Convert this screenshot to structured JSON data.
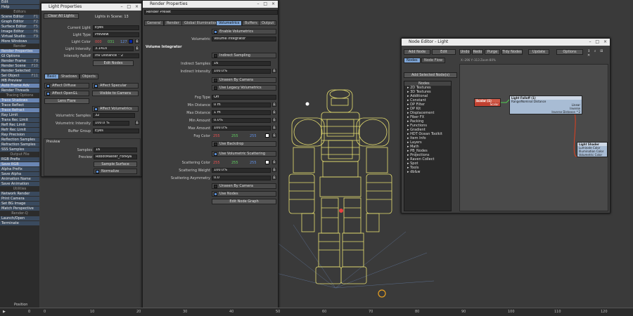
{
  "left_menu": {
    "items": [
      {
        "label": "Edit",
        "key": "",
        "type": "item"
      },
      {
        "label": "Help",
        "key": "",
        "type": "item"
      },
      {
        "label": "Editors",
        "key": "",
        "type": "header"
      },
      {
        "label": "Scene Editor",
        "key": "F1",
        "type": "item"
      },
      {
        "label": "Graph Editor",
        "key": "F2",
        "type": "item"
      },
      {
        "label": "Surface Editor",
        "key": "F5",
        "type": "item"
      },
      {
        "label": "Image Editor",
        "key": "F6",
        "type": "item"
      },
      {
        "label": "Virtual Studio",
        "key": "F9",
        "type": "item"
      },
      {
        "label": "More Windows",
        "key": "",
        "type": "item"
      },
      {
        "label": "Render",
        "key": "",
        "type": "header"
      },
      {
        "label": "Render Properties",
        "key": "",
        "type": "item",
        "active": true
      },
      {
        "label": "GI Options",
        "key": "",
        "type": "item"
      },
      {
        "label": "Render Frame",
        "key": "F9",
        "type": "item"
      },
      {
        "label": "Render Scene",
        "key": "F10",
        "type": "item"
      },
      {
        "label": "Render Selected",
        "key": "",
        "type": "item"
      },
      {
        "label": "Sel Object",
        "key": "F11",
        "type": "item"
      },
      {
        "label": "MB Preview",
        "key": "",
        "type": "item"
      },
      {
        "label": "Auto Frame Adv",
        "key": "",
        "type": "item",
        "active": true
      },
      {
        "label": "Render Threads",
        "key": "",
        "type": "item"
      },
      {
        "label": "Tracing Options",
        "key": "",
        "type": "header"
      },
      {
        "label": "Trace Shadows",
        "key": "",
        "type": "item",
        "active": true
      },
      {
        "label": "Trace Reflect",
        "key": "",
        "type": "item"
      },
      {
        "label": "Trace Refract",
        "key": "",
        "type": "item",
        "active": true
      },
      {
        "label": "Ray Limit",
        "key": "",
        "type": "item"
      },
      {
        "label": "Trans Rec Limit",
        "key": "",
        "type": "item"
      },
      {
        "label": "Refl Rec Limit",
        "key": "",
        "type": "item"
      },
      {
        "label": "Refr Rec Limit",
        "key": "",
        "type": "item"
      },
      {
        "label": "Ray Precision",
        "key": "",
        "type": "item"
      },
      {
        "label": "Reflection Samples",
        "key": "",
        "type": "item"
      },
      {
        "label": "Refraction Samples",
        "key": "",
        "type": "item"
      },
      {
        "label": "SSS Samples",
        "key": "",
        "type": "item"
      },
      {
        "label": "Output File",
        "key": "",
        "type": "header"
      },
      {
        "label": "RGB Prefix",
        "key": "",
        "type": "item"
      },
      {
        "label": "Save RGB",
        "key": "",
        "type": "item",
        "active": true
      },
      {
        "label": "Alpha Prefix",
        "key": "",
        "type": "item"
      },
      {
        "label": "Save Alpha",
        "key": "",
        "type": "item"
      },
      {
        "label": "Animation Name",
        "key": "",
        "type": "item"
      },
      {
        "label": "Save Animation",
        "key": "",
        "type": "item"
      },
      {
        "label": "Utilities",
        "key": "",
        "type": "header"
      },
      {
        "label": "Network Render",
        "key": "",
        "type": "item"
      },
      {
        "label": "Print Camera",
        "key": "",
        "type": "item"
      },
      {
        "label": "Set BG Image",
        "key": "",
        "type": "item"
      },
      {
        "label": "Match Perspective",
        "key": "",
        "type": "item"
      },
      {
        "label": "Render-Q",
        "key": "",
        "type": "header"
      },
      {
        "label": "Launch/Open",
        "key": "",
        "type": "item"
      },
      {
        "label": "Terminate",
        "key": "",
        "type": "item"
      }
    ]
  },
  "light_props": {
    "title": "Light Properties",
    "clear_all": "Clear All Lights",
    "lights_in_scene": "Lights in Scene: 13",
    "current_light_label": "Current Light",
    "current_light": "Eyes",
    "light_type_label": "Light Type",
    "light_type": "Preview",
    "light_color_label": "Light Color",
    "rgb": [
      "000",
      "031",
      "127"
    ],
    "intensity_label": "Light Intensity",
    "intensity": "3.141s",
    "falloff_label": "Intensity Falloff",
    "falloff": "Inv Distance ^2",
    "edit_nodes": "Edit Nodes",
    "tabs": [
      "Basic",
      "Shadows",
      "Objects"
    ],
    "affect_diffuse": "Affect Diffuse",
    "affect_specular": "Affect Specular",
    "affect_opengl": "Affect OpenGL",
    "visible_camera": "Visible to Camera",
    "lens_flare": "Lens Flare",
    "affect_volumetrics": "Affect Volumetrics",
    "vol_samples_label": "Volumetric Samples",
    "vol_samples": "32",
    "vol_intensity_label": "Volumetric Intensity",
    "vol_intensity": "100.0 %",
    "buffer_group_label": "Buffer Group",
    "buffer_group": "Eyes",
    "preview_section": "Preview",
    "samples_label": "Samples",
    "samples": "16",
    "preview_label": "Preview",
    "preview": "RobotMaster_ForRya",
    "sample_surface": "Sample Surface",
    "normalize": "Normalize"
  },
  "render_props": {
    "title": "Render Properties",
    "preset": "Render Preset",
    "tabs": [
      "General",
      "Render",
      "Global Illumination",
      "Volumetrics",
      "Buffers",
      "Output"
    ],
    "enable_vol": "Enable Volumetrics",
    "volumetric_label": "Volumetric",
    "volumetric": "Volume Integrator",
    "section": "Volume Integrator",
    "indirect_sampling": "Indirect Sampling",
    "ind_samples_label": "Indirect Samples",
    "ind_samples": "16",
    "ind_intensity_label": "Indirect Intensity",
    "ind_intensity": "100.0%",
    "unseen_camera": "Unseen By Camera",
    "use_legacy": "Use Legacy Volumetrics",
    "fog_type_label": "Fog Type",
    "fog_type": "Off",
    "min_dist_label": "Min Distance",
    "min_dist": "0 m",
    "max_dist_label": "Max Distance",
    "max_dist": "1 m",
    "min_amount_label": "Min Amount",
    "min_amount": "0.0%",
    "max_amount_label": "Max Amount",
    "max_amount": "100.0%",
    "fog_color_label": "Fog Color",
    "fog_rgb": [
      "255",
      "255",
      "255"
    ],
    "use_backdrop": "Use Backdrop",
    "use_vol_scatter": "Use Volumetric Scattering",
    "scat_color_label": "Scattering Color",
    "scat_rgb": [
      "255",
      "255",
      "255"
    ],
    "scat_weight_label": "Scattering Weight",
    "scat_weight": "100.0%",
    "scat_asym_label": "Scattering Asymmetry",
    "scat_asym": "0.0",
    "unseen_camera2": "Unseen By Camera",
    "use_nodes": "Use Nodes",
    "edit_node_graph": "Edit Node Graph"
  },
  "node_editor": {
    "title": "Node Editor - Light",
    "toolbar": [
      "Add Node",
      "Edit",
      "Undo",
      "Redo",
      "Purge",
      "Tidy Nodes",
      "Update",
      "Options"
    ],
    "tabs": [
      "Nodes",
      "Node Flow"
    ],
    "coords": "X:-296 Y:-313 Zoom:80%",
    "add_selected": "Add Selected Node(s)",
    "tree_header": "Nodes",
    "tree": [
      "2D Textures",
      "3D Textures",
      "Additional",
      "Constant",
      "DP Filter",
      "DP Kit",
      "Displacement",
      "Fiber FX",
      "Packing",
      "Functions",
      "Gradient",
      "HDT Ocean Toolkit",
      "Item Info",
      "Layers",
      "Math",
      "PB_Nodes",
      "Projections",
      "Raven Collect",
      "Spot",
      "Tools",
      "db&w"
    ],
    "scalar_node": {
      "title": "Scalar (1)",
      "out": "Scalar"
    },
    "falloff_node": {
      "title": "Light Falloff (1)",
      "range": "Range/Nominal Distance",
      "outs": [
        "Linear",
        "Inverse",
        "Inverse Distance ^2"
      ]
    },
    "shader_node": {
      "title": "Light Shader",
      "ins": [
        "Luminate Color",
        "Illumination Color",
        "Volumetric Color"
      ]
    }
  },
  "timeline": {
    "label": "Position",
    "start": "0",
    "ticks": [
      "0",
      "10",
      "20",
      "30",
      "40",
      "50",
      "60",
      "70",
      "80",
      "90",
      "100",
      "110",
      "120"
    ],
    "colors": {
      "accent": "#6a86b4",
      "wire": "#e8e070"
    }
  }
}
